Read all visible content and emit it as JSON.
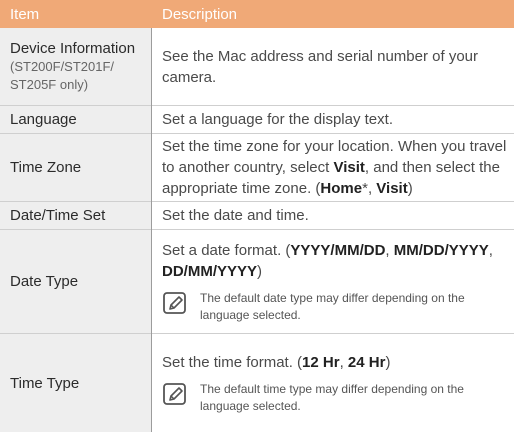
{
  "header": {
    "item": "Item",
    "description": "Description"
  },
  "rows": [
    {
      "item": "Device Information",
      "item_sub": "(ST200F/ST201F/ ST205F only)",
      "desc": [
        "See the Mac address and serial number of your camera."
      ]
    },
    {
      "item": "Language",
      "desc": [
        "Set a language for the display text."
      ]
    },
    {
      "item": "Time Zone",
      "desc": [
        "Set the time zone for your location. When you travel to another country, select ",
        "Visit",
        ", and then select the appropriate time zone. (",
        "Home",
        "*, ",
        "Visit",
        ")"
      ]
    },
    {
      "item": "Date/Time Set",
      "desc": [
        "Set the date and time."
      ]
    },
    {
      "item": "Date Type",
      "desc": [
        "Set a date format. (",
        "YYYY/MM/DD",
        ", ",
        "MM/DD/YYYY",
        ", ",
        "DD/MM/YYYY",
        ")"
      ],
      "note": "The default date type may differ depending on the language selected."
    },
    {
      "item": "Time Type",
      "desc": [
        "Set the time format. (",
        "12 Hr",
        ", ",
        "24 Hr",
        ")"
      ],
      "note": "The default time type may differ depending on the language selected."
    }
  ],
  "colors": {
    "header_bg": "#f0a977",
    "item_col_bg": "#eeeeee",
    "divider": "#9c9c9c",
    "row_border": "#cfcfcf"
  },
  "icons": {
    "note": "note-pencil-icon"
  }
}
